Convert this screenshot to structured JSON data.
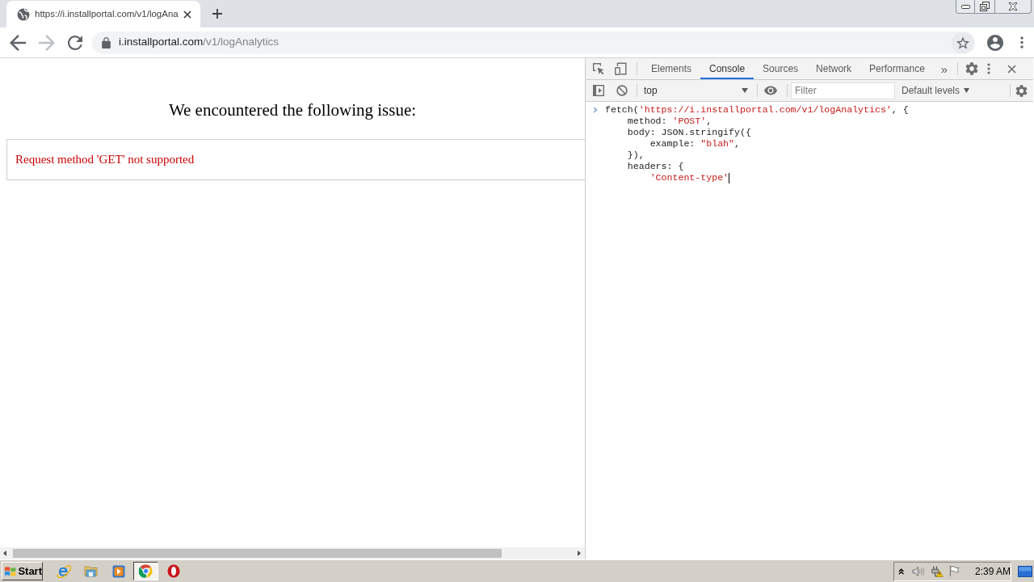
{
  "browser": {
    "tabs": [
      {
        "title": "https://i.installportal.com/v1/logAna",
        "selected": true
      }
    ],
    "address_bar": {
      "host": "i.installportal.com",
      "path": "/v1/logAnalytics"
    }
  },
  "page": {
    "heading": "We encountered the following issue:",
    "error_message": "Request method 'GET' not supported"
  },
  "devtools": {
    "tabs": [
      {
        "label": "Elements",
        "selected": false
      },
      {
        "label": "Console",
        "selected": true
      },
      {
        "label": "Sources",
        "selected": false
      },
      {
        "label": "Network",
        "selected": false
      },
      {
        "label": "Performance",
        "selected": false
      }
    ],
    "more_tabs": "»",
    "context": "top",
    "filter": {
      "placeholder": "Filter"
    },
    "levels": "Default levels",
    "console_input": [
      [
        {
          "kind": "plain",
          "text": "fetch("
        },
        {
          "kind": "string",
          "text": "'https://i.installportal.com/v1/logAnalytics'"
        },
        {
          "kind": "plain",
          "text": ", {"
        }
      ],
      [
        {
          "kind": "plain",
          "text": "    method: "
        },
        {
          "kind": "string",
          "text": "'POST'"
        },
        {
          "kind": "plain",
          "text": ","
        }
      ],
      [
        {
          "kind": "plain",
          "text": "    body: JSON.stringify({"
        }
      ],
      [
        {
          "kind": "plain",
          "text": "        example: "
        },
        {
          "kind": "string",
          "text": "\"blah\""
        },
        {
          "kind": "plain",
          "text": ","
        }
      ],
      [
        {
          "kind": "plain",
          "text": "    }),"
        }
      ],
      [
        {
          "kind": "plain",
          "text": "    headers: {"
        }
      ],
      [
        {
          "kind": "string",
          "text": "        'Content-type'"
        }
      ]
    ]
  },
  "taskbar": {
    "start": "Start",
    "apps": [
      {
        "kind": "e_logo",
        "selected": false
      },
      {
        "kind": "folder",
        "selected": false
      },
      {
        "kind": "media",
        "selected": false
      },
      {
        "kind": "ring_logo",
        "selected": true
      },
      {
        "kind": "o_logo",
        "selected": false
      }
    ],
    "clock": "2:39 AM"
  }
}
